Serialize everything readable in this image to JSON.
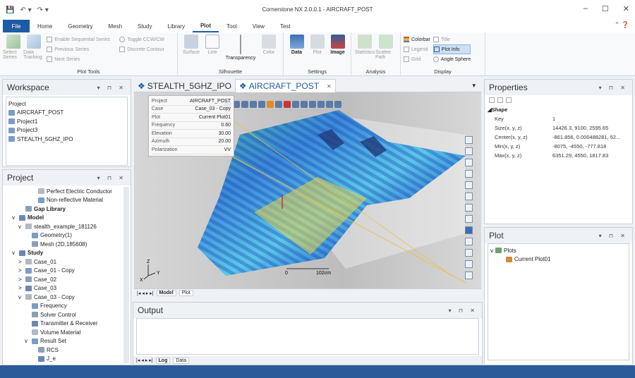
{
  "window": {
    "title": "Cornerstone NX 2.0.0.1 - AIRCRAFT_POST",
    "minimize": "–",
    "maximize": "☐",
    "close": "✕"
  },
  "qat": {
    "save": "💾",
    "undo": "↶ ▾",
    "redo": "↷ ▾"
  },
  "ribbon_tabs": {
    "file": "File",
    "tabs": [
      "Home",
      "Geometry",
      "Mesh",
      "Study",
      "Library",
      "Plot",
      "Tool",
      "View",
      "Test"
    ],
    "active": "Plot",
    "help": "⌃ ❓"
  },
  "ribbon": {
    "plot_tools": {
      "label": "Plot Tools",
      "select_series": "Select Series",
      "data_tracking": "Data Tracking",
      "enable_sequential": "Enable Sequential Series",
      "previous_series": "Previous Series",
      "next_series": "Next Series",
      "toggle": "Toggle CCW/CW",
      "discrete": "Discrete Contour"
    },
    "silhouette": {
      "label": "Silhouette",
      "surface": "Surface",
      "line": "Line",
      "transparency": "Transparency",
      "color": "Color"
    },
    "settings": {
      "label": "Settings",
      "data": "Data",
      "plot": "Plot",
      "image": "Image"
    },
    "analysis": {
      "label": "Analysis",
      "statistics": "Statistics",
      "scatter_path": "Scatter Path"
    },
    "display": {
      "label": "Display",
      "colorbar": "Colorbar",
      "title": "Title",
      "legend": "Legend",
      "plot_info": "Plot Info",
      "grid": "Grid",
      "angle_sphere": "Angle Sphere"
    }
  },
  "workspace": {
    "title": "Workspace",
    "controls": "▾ ⊓ ✕",
    "header": "Project",
    "items": [
      "AIRCRAFT_POST",
      "Project1",
      "Project3",
      "STEALTH_5GHZ_IPO"
    ]
  },
  "project": {
    "title": "Project",
    "controls": "▾ ⊓ ✕",
    "tree": [
      {
        "label": "Perfect Electric Conductor",
        "indent": 4,
        "arrow": ""
      },
      {
        "label": "Non-reflective Material",
        "indent": 4,
        "arrow": ""
      },
      {
        "label": "Gap Library",
        "indent": 2,
        "arrow": "",
        "bold": true
      },
      {
        "label": "Model",
        "indent": 1,
        "arrow": "v",
        "bold": true
      },
      {
        "label": "stealth_example_181126",
        "indent": 2,
        "arrow": "v"
      },
      {
        "label": "Geometry(1)",
        "indent": 3,
        "arrow": ""
      },
      {
        "label": "Mesh (2D,185608)",
        "indent": 3,
        "arrow": ""
      },
      {
        "label": "Study",
        "indent": 1,
        "arrow": "v",
        "bold": true
      },
      {
        "label": "Case_01",
        "indent": 2,
        "arrow": ">"
      },
      {
        "label": "Case_01 - Copy",
        "indent": 2,
        "arrow": ">"
      },
      {
        "label": "Case_02",
        "indent": 2,
        "arrow": ">"
      },
      {
        "label": "Case_03",
        "indent": 2,
        "arrow": ">"
      },
      {
        "label": "Case_03 - Copy",
        "indent": 2,
        "arrow": "v"
      },
      {
        "label": "Frequency",
        "indent": 3,
        "arrow": ""
      },
      {
        "label": "Solver Control",
        "indent": 3,
        "arrow": ""
      },
      {
        "label": "Transmitter & Receiver",
        "indent": 3,
        "arrow": ""
      },
      {
        "label": "Volume Material",
        "indent": 3,
        "arrow": ""
      },
      {
        "label": "Result Set",
        "indent": 3,
        "arrow": "v"
      },
      {
        "label": "RCS",
        "indent": 4,
        "arrow": ""
      },
      {
        "label": "J_e",
        "indent": 4,
        "arrow": ""
      }
    ]
  },
  "doc_tabs": {
    "tab1": "STEALTH_5GHZ_IPO",
    "tab2": "AIRCRAFT_POST",
    "close": "✕",
    "dropdown": "▾"
  },
  "plot_info": [
    {
      "k": "Project",
      "v": "AIRCRAFT_POST"
    },
    {
      "k": "Case",
      "v": "Case_03 - Copy"
    },
    {
      "k": "Plot",
      "v": "Current Plot01"
    },
    {
      "k": "Frequency",
      "v": "0.60"
    },
    {
      "k": "Elevation",
      "v": "30.00"
    },
    {
      "k": "Azimuth",
      "v": "20.00"
    },
    {
      "k": "Polarization",
      "v": "VV"
    }
  ],
  "viewport": {
    "scale_min": "0",
    "scale_max": "102cm",
    "axis_z": "Z",
    "axis_x": "X",
    "axis_y": "Y",
    "bottom_tabs": [
      "Model",
      "Plot"
    ],
    "nav": "|◂ ◂ ▸ ▸|"
  },
  "output": {
    "title": "Output",
    "controls": "▾ ⊓ ✕",
    "tabs": [
      "Log",
      "Data"
    ],
    "nav": "|◂ ◂ ▸ ▸|"
  },
  "properties": {
    "title": "Properties",
    "controls": "▾ ⊓ ✕",
    "section": "Shape",
    "rows": [
      {
        "k": "Key",
        "v": "1"
      },
      {
        "k": "Size(x, y, z)",
        "v": "14426.3, 9100, 2595.65"
      },
      {
        "k": "Center(x, y, z)",
        "v": "-861.856, 0.000488281, 52..."
      },
      {
        "k": "Min(x, y, z)",
        "v": "-8075, -4550, -777.818"
      },
      {
        "k": "Max(x, y, z)",
        "v": "6351.29, 4550, 1817.83"
      }
    ]
  },
  "plot_panel": {
    "title": "Plot",
    "controls": "▾ ⊓ ✕",
    "root": "Plots",
    "child": "Current Plot01"
  },
  "colors": {
    "accent": "#1f5aa6",
    "status": "#2b5c99"
  }
}
